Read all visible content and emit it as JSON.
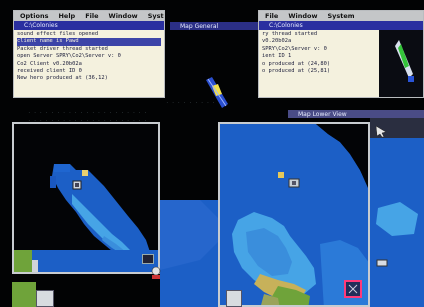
{
  "left_window": {
    "menu": [
      "Options",
      "Help",
      "File",
      "Window",
      "System"
    ],
    "title": "C:\\Colonies",
    "log_lines": [
      "sound effect files opened",
      "client name is Pawd",
      "Packet driver thread started",
      "open Server SPRY\\Co2\\Server v: 0",
      "Co2 Client v0.20b02a",
      "received client ID 0",
      "New hero produced at (36,12)"
    ],
    "selected_line": 1
  },
  "right_window": {
    "menu": [
      "File",
      "Window",
      "System"
    ],
    "title": "C:\\Colonies",
    "log_lines": [
      "ry thread started",
      "v0.20b02a",
      "SPRY\\Co2\\Server v: 0",
      "ient ID 1",
      "o produced at (24,80)",
      "o produced at (25,81)"
    ]
  },
  "middle_title": "Map General",
  "right_sub_title": "Map Lower View",
  "colors": {
    "deep_water": "#1c5fc6",
    "shallow_water": "#46a4e6",
    "grass": "#6fa33a",
    "sand": "#c7b15a",
    "void": "#030406",
    "menu": "#c4c6c8",
    "log_bg": "#f4f1de",
    "title": "#2a2fa0"
  },
  "icons": [
    "unit-icon",
    "ship-icon",
    "settler-icon",
    "cursor-arrow-icon",
    "satellite-icon"
  ]
}
